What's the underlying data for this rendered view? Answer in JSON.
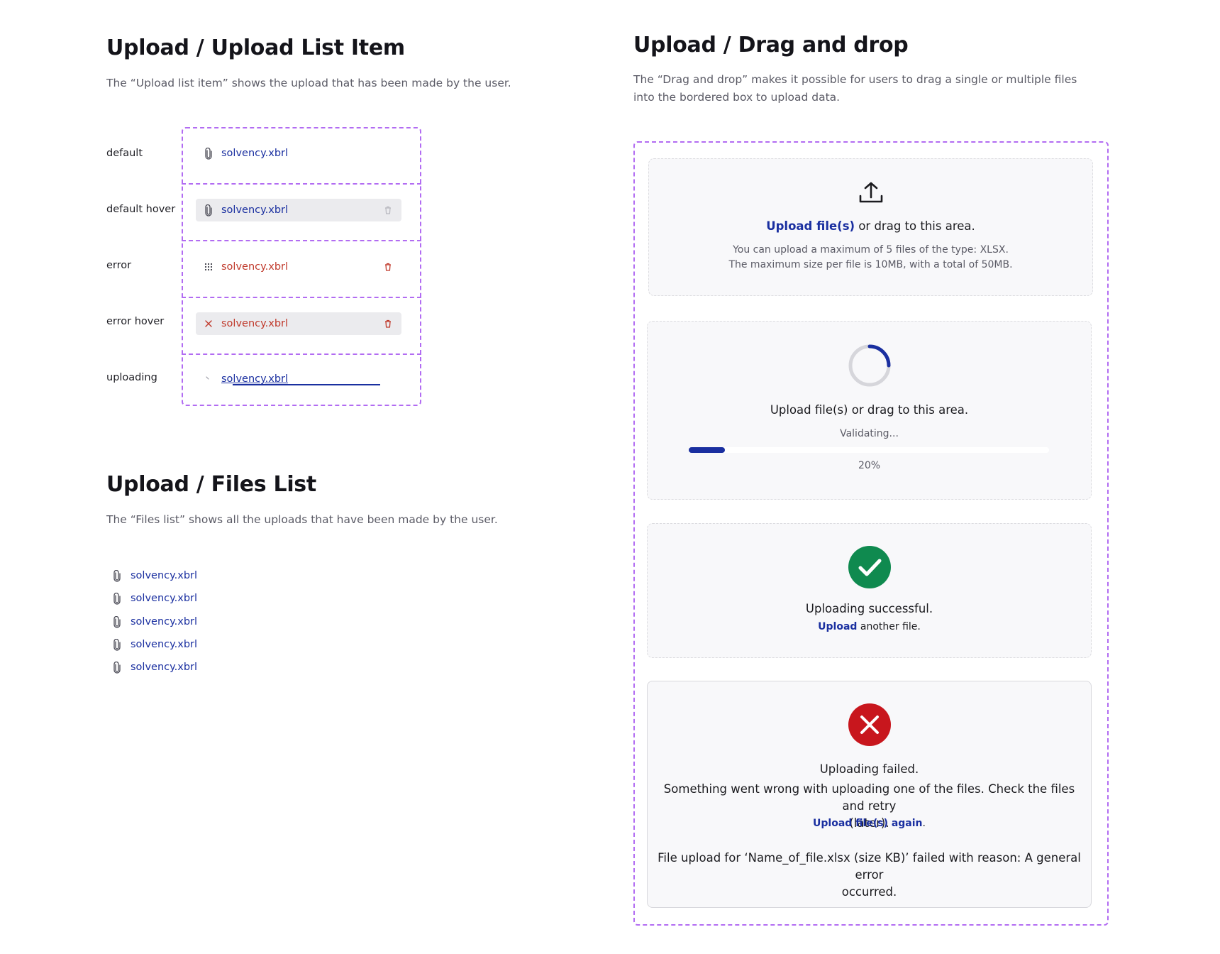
{
  "list_item_section": {
    "title": "Upload / Upload List Item",
    "description": "The “Upload list item” shows the upload that has been made by the user.",
    "variants": [
      {
        "state_label": "default",
        "file_name": "solvency.xbrl",
        "icon": "paperclip-icon"
      },
      {
        "state_label": "default hover",
        "file_name": "solvency.xbrl",
        "icon": "paperclip-icon",
        "action_icon": "trash-icon"
      },
      {
        "state_label": "error",
        "file_name": "solvency.xbrl",
        "icon": "drag-handle-icon",
        "action_icon": "trash-icon"
      },
      {
        "state_label": "error hover",
        "file_name": "solvency.xbrl",
        "icon": "close-icon",
        "action_icon": "trash-icon"
      },
      {
        "state_label": "uploading",
        "file_name": "solvency.xbrl",
        "icon": "spinner-icon"
      }
    ]
  },
  "files_list_section": {
    "title": "Upload / Files List",
    "description": "The “Files list” shows all the uploads that have been made by the user.",
    "files": [
      "solvency.xbrl",
      "solvency.xbrl",
      "solvency.xbrl",
      "solvency.xbrl",
      "solvency.xbrl"
    ]
  },
  "drag_drop_section": {
    "title": "Upload / Drag and drop",
    "description_line1": "The “Drag and drop” makes it possible for users to drag a single or multiple files",
    "description_line2": "into the bordered box to upload data.",
    "default_box": {
      "link_text": "Upload file(s)",
      "rest_text": " or drag to this area.",
      "hint_line1": "You can upload a maximum of 5 files of the type: XLSX.",
      "hint_line2": "The maximum size per file is 10MB, with a total of 50MB."
    },
    "validating_box": {
      "main_text": "Upload file(s) or drag to this area.",
      "status_text": "Validating...",
      "progress": 0.1,
      "progress_label": "20%"
    },
    "success_box": {
      "title": "Uploading successful.",
      "link_text": "Upload",
      "rest_text": " another file."
    },
    "failed_box": {
      "title": "Uploading failed.",
      "message_line1": "Something went wrong with uploading one of the files. Check the files and retry",
      "message_line2": "(later).",
      "link_text": "Upload file(s) again",
      "link_suffix": ".",
      "detail_line1": "File upload for ‘Name_of_file.xlsx (size KB)’ failed with reason: A general error",
      "detail_line2": "occurred."
    }
  },
  "colors": {
    "link": "#1a2fa0",
    "error": "#c0392b",
    "success": "#0f8a4f",
    "danger": "#c8161d",
    "dashed_outline": "#b26cf2"
  }
}
